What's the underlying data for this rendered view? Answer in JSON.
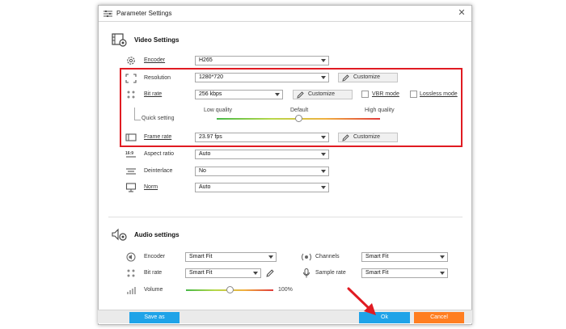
{
  "window": {
    "title": "Parameter Settings"
  },
  "video": {
    "title": "Video Settings",
    "encoder": {
      "label": "Encoder",
      "value": "H265"
    },
    "resolution": {
      "label": "Resolution",
      "value": "1280*720",
      "button": "Customize"
    },
    "bitrate": {
      "label": "Bit rate",
      "value": "256 kbps",
      "button": "Customize",
      "vbr": "VBR mode",
      "lossless": "Lossless mode"
    },
    "quality": {
      "label": "Quick setting",
      "low": "Low quality",
      "default": "Default",
      "high": "High quality",
      "level": 0.5
    },
    "framerate": {
      "label": "Frame rate",
      "value": "23.97 fps",
      "button": "Customize"
    },
    "aspect": {
      "label": "Aspect ratio",
      "value": "Auto"
    },
    "deinterlace": {
      "label": "Deinterlace",
      "value": "No"
    },
    "norm": {
      "label": "Norm",
      "value": "Auto"
    }
  },
  "audio": {
    "title": "Audio settings",
    "encoder": {
      "label": "Encoder",
      "value": "Smart Fit"
    },
    "bitrate": {
      "label": "Bit rate",
      "value": "Smart Fit"
    },
    "volume": {
      "label": "Volume",
      "value": "100%",
      "level": 0.5
    },
    "channels": {
      "label": "Channels",
      "value": "Smart Fit"
    },
    "samplerate": {
      "label": "Sample rate",
      "value": "Smart Fit"
    }
  },
  "footer": {
    "save_as": "Save as",
    "ok": "Ok",
    "cancel": "Cancel"
  },
  "colors": {
    "highlight": "#e01b22",
    "primary_button": "#1fa3e8",
    "cancel_button": "#ff7e21"
  }
}
